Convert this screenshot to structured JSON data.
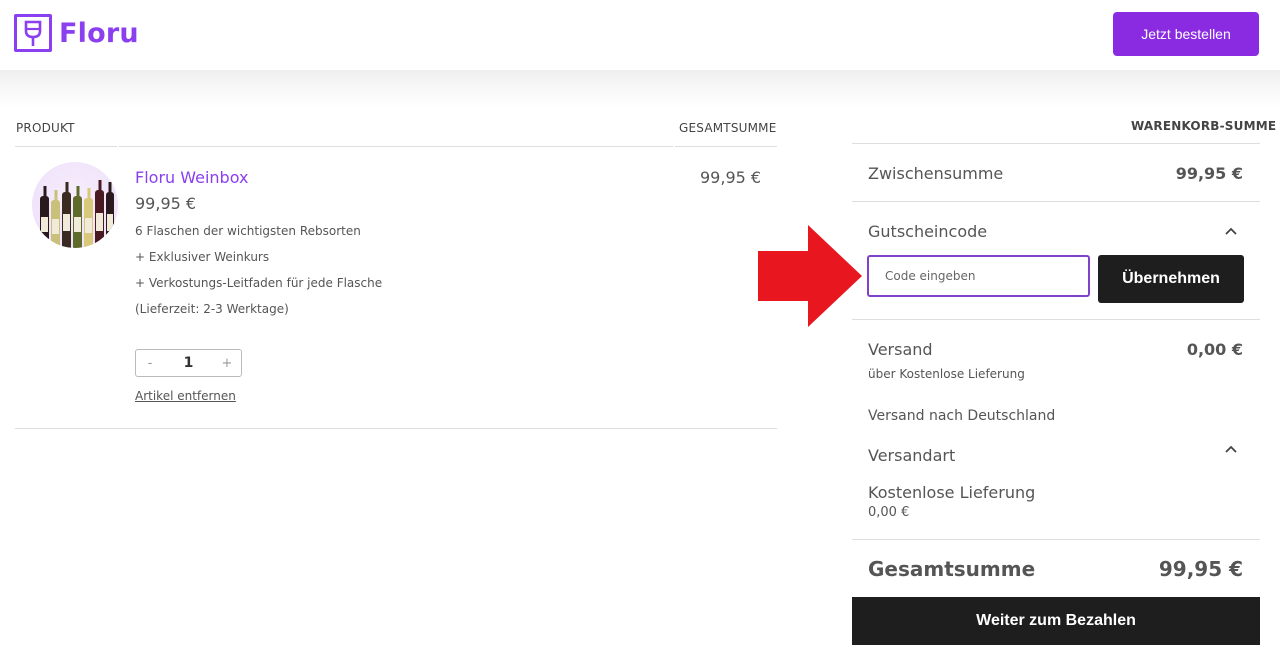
{
  "header": {
    "brand": "Floru",
    "order_button": "Jetzt bestellen"
  },
  "cart": {
    "col_product": "PRODUKT",
    "col_total": "GESAMTSUMME",
    "item": {
      "title": "Floru Weinbox",
      "price": "99,95 €",
      "lines": [
        "6 Flaschen der wichtigsten Rebsorten",
        "+ Exklusiver Weinkurs",
        "+ Verkostungs-Leitfaden für jede Flasche",
        "(Lieferzeit: 2-3 Werktage)"
      ],
      "line_total": "99,95 €",
      "qty_minus": "-",
      "quantity": "1",
      "qty_plus": "+",
      "remove": "Artikel entfernen"
    }
  },
  "totals": {
    "heading": "WARENKORB-SUMME",
    "subtotal_label": "Zwischensumme",
    "subtotal_value": "99,95 €",
    "coupon_label": "Gutscheincode",
    "coupon_placeholder": "Code eingeben",
    "coupon_apply": "Übernehmen",
    "shipping_label": "Versand",
    "shipping_value": "0,00 €",
    "shipping_note": "über Kostenlose Lieferung",
    "shipping_destination": "Versand nach Deutschland",
    "shipping_method_label": "Versandart",
    "shipping_method_name": "Kostenlose Lieferung",
    "shipping_method_price": "0,00 €",
    "grand_label": "Gesamtsumme",
    "grand_value": "99,95 €",
    "checkout_button": "Weiter zum Bezahlen"
  },
  "colors": {
    "brand": "#8a3ff0",
    "primary_button": "#8a2be2",
    "dark_button": "#1e1e1e",
    "annotation_arrow": "#e8161f"
  }
}
